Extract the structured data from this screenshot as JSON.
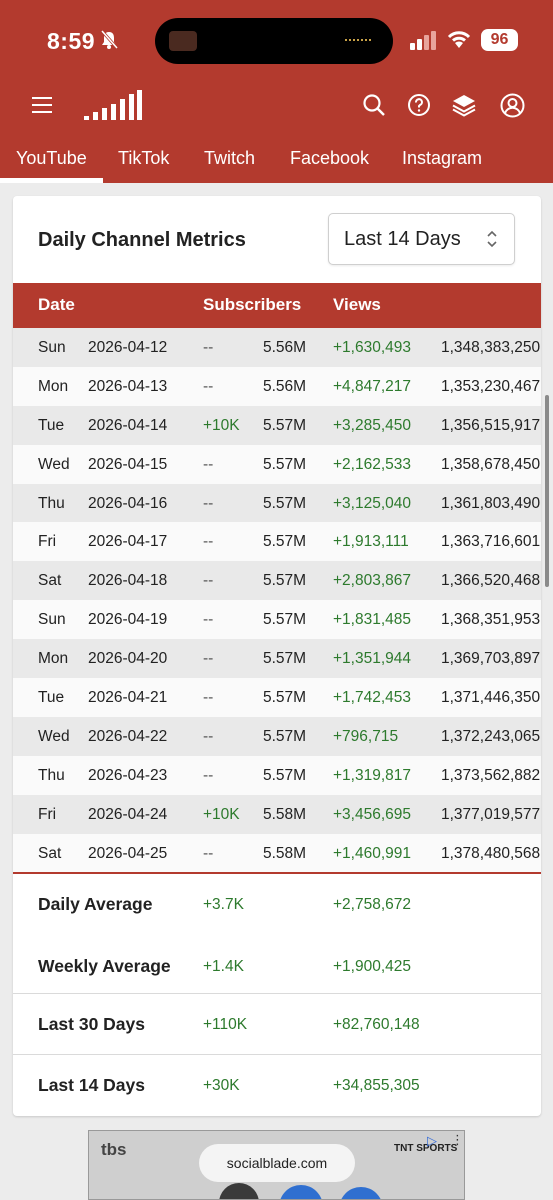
{
  "status_bar": {
    "time": "8:59",
    "battery": "96"
  },
  "platform_tabs": [
    "YouTube",
    "TikTok",
    "Twitch",
    "Facebook",
    "Instagram"
  ],
  "card": {
    "title": "Daily Channel Metrics",
    "range_selected": "Last 14 Days",
    "columns": {
      "date": "Date",
      "subscribers": "Subscribers",
      "views": "Views"
    },
    "rows": [
      {
        "day": "Sun",
        "date": "2026-04-12",
        "sub_change": "--",
        "sub_total": "5.56M",
        "views_change": "+1,630,493",
        "views_total": "1,348,383,250"
      },
      {
        "day": "Mon",
        "date": "2026-04-13",
        "sub_change": "--",
        "sub_total": "5.56M",
        "views_change": "+4,847,217",
        "views_total": "1,353,230,467"
      },
      {
        "day": "Tue",
        "date": "2026-04-14",
        "sub_change": "+10K",
        "sub_total": "5.57M",
        "views_change": "+3,285,450",
        "views_total": "1,356,515,917"
      },
      {
        "day": "Wed",
        "date": "2026-04-15",
        "sub_change": "--",
        "sub_total": "5.57M",
        "views_change": "+2,162,533",
        "views_total": "1,358,678,450"
      },
      {
        "day": "Thu",
        "date": "2026-04-16",
        "sub_change": "--",
        "sub_total": "5.57M",
        "views_change": "+3,125,040",
        "views_total": "1,361,803,490"
      },
      {
        "day": "Fri",
        "date": "2026-04-17",
        "sub_change": "--",
        "sub_total": "5.57M",
        "views_change": "+1,913,111",
        "views_total": "1,363,716,601"
      },
      {
        "day": "Sat",
        "date": "2026-04-18",
        "sub_change": "--",
        "sub_total": "5.57M",
        "views_change": "+2,803,867",
        "views_total": "1,366,520,468"
      },
      {
        "day": "Sun",
        "date": "2026-04-19",
        "sub_change": "--",
        "sub_total": "5.57M",
        "views_change": "+1,831,485",
        "views_total": "1,368,351,953"
      },
      {
        "day": "Mon",
        "date": "2026-04-20",
        "sub_change": "--",
        "sub_total": "5.57M",
        "views_change": "+1,351,944",
        "views_total": "1,369,703,897"
      },
      {
        "day": "Tue",
        "date": "2026-04-21",
        "sub_change": "--",
        "sub_total": "5.57M",
        "views_change": "+1,742,453",
        "views_total": "1,371,446,350"
      },
      {
        "day": "Wed",
        "date": "2026-04-22",
        "sub_change": "--",
        "sub_total": "5.57M",
        "views_change": "+796,715",
        "views_total": "1,372,243,065"
      },
      {
        "day": "Thu",
        "date": "2026-04-23",
        "sub_change": "--",
        "sub_total": "5.57M",
        "views_change": "+1,319,817",
        "views_total": "1,373,562,882"
      },
      {
        "day": "Fri",
        "date": "2026-04-24",
        "sub_change": "+10K",
        "sub_total": "5.58M",
        "views_change": "+3,456,695",
        "views_total": "1,377,019,577"
      },
      {
        "day": "Sat",
        "date": "2026-04-25",
        "sub_change": "--",
        "sub_total": "5.58M",
        "views_change": "+1,460,991",
        "views_total": "1,378,480,568"
      }
    ],
    "summary": [
      {
        "label": "Daily Average",
        "subs": "+3.7K",
        "views": "+2,758,672"
      },
      {
        "label": "Weekly Average",
        "subs": "+1.4K",
        "views": "+1,900,425"
      },
      {
        "label": "Last 30 Days",
        "subs": "+110K",
        "views": "+82,760,148"
      },
      {
        "label": "Last 14 Days",
        "subs": "+30K",
        "views": "+34,855,305"
      }
    ]
  },
  "ad": {
    "brand_left": "tbs",
    "url_pill": "socialblade.com",
    "brand_right": "TNT SPORTS"
  },
  "colors": {
    "brand": "#b33a2e",
    "positive": "#2d7a2d",
    "row_alt": "#e9e9e9"
  }
}
